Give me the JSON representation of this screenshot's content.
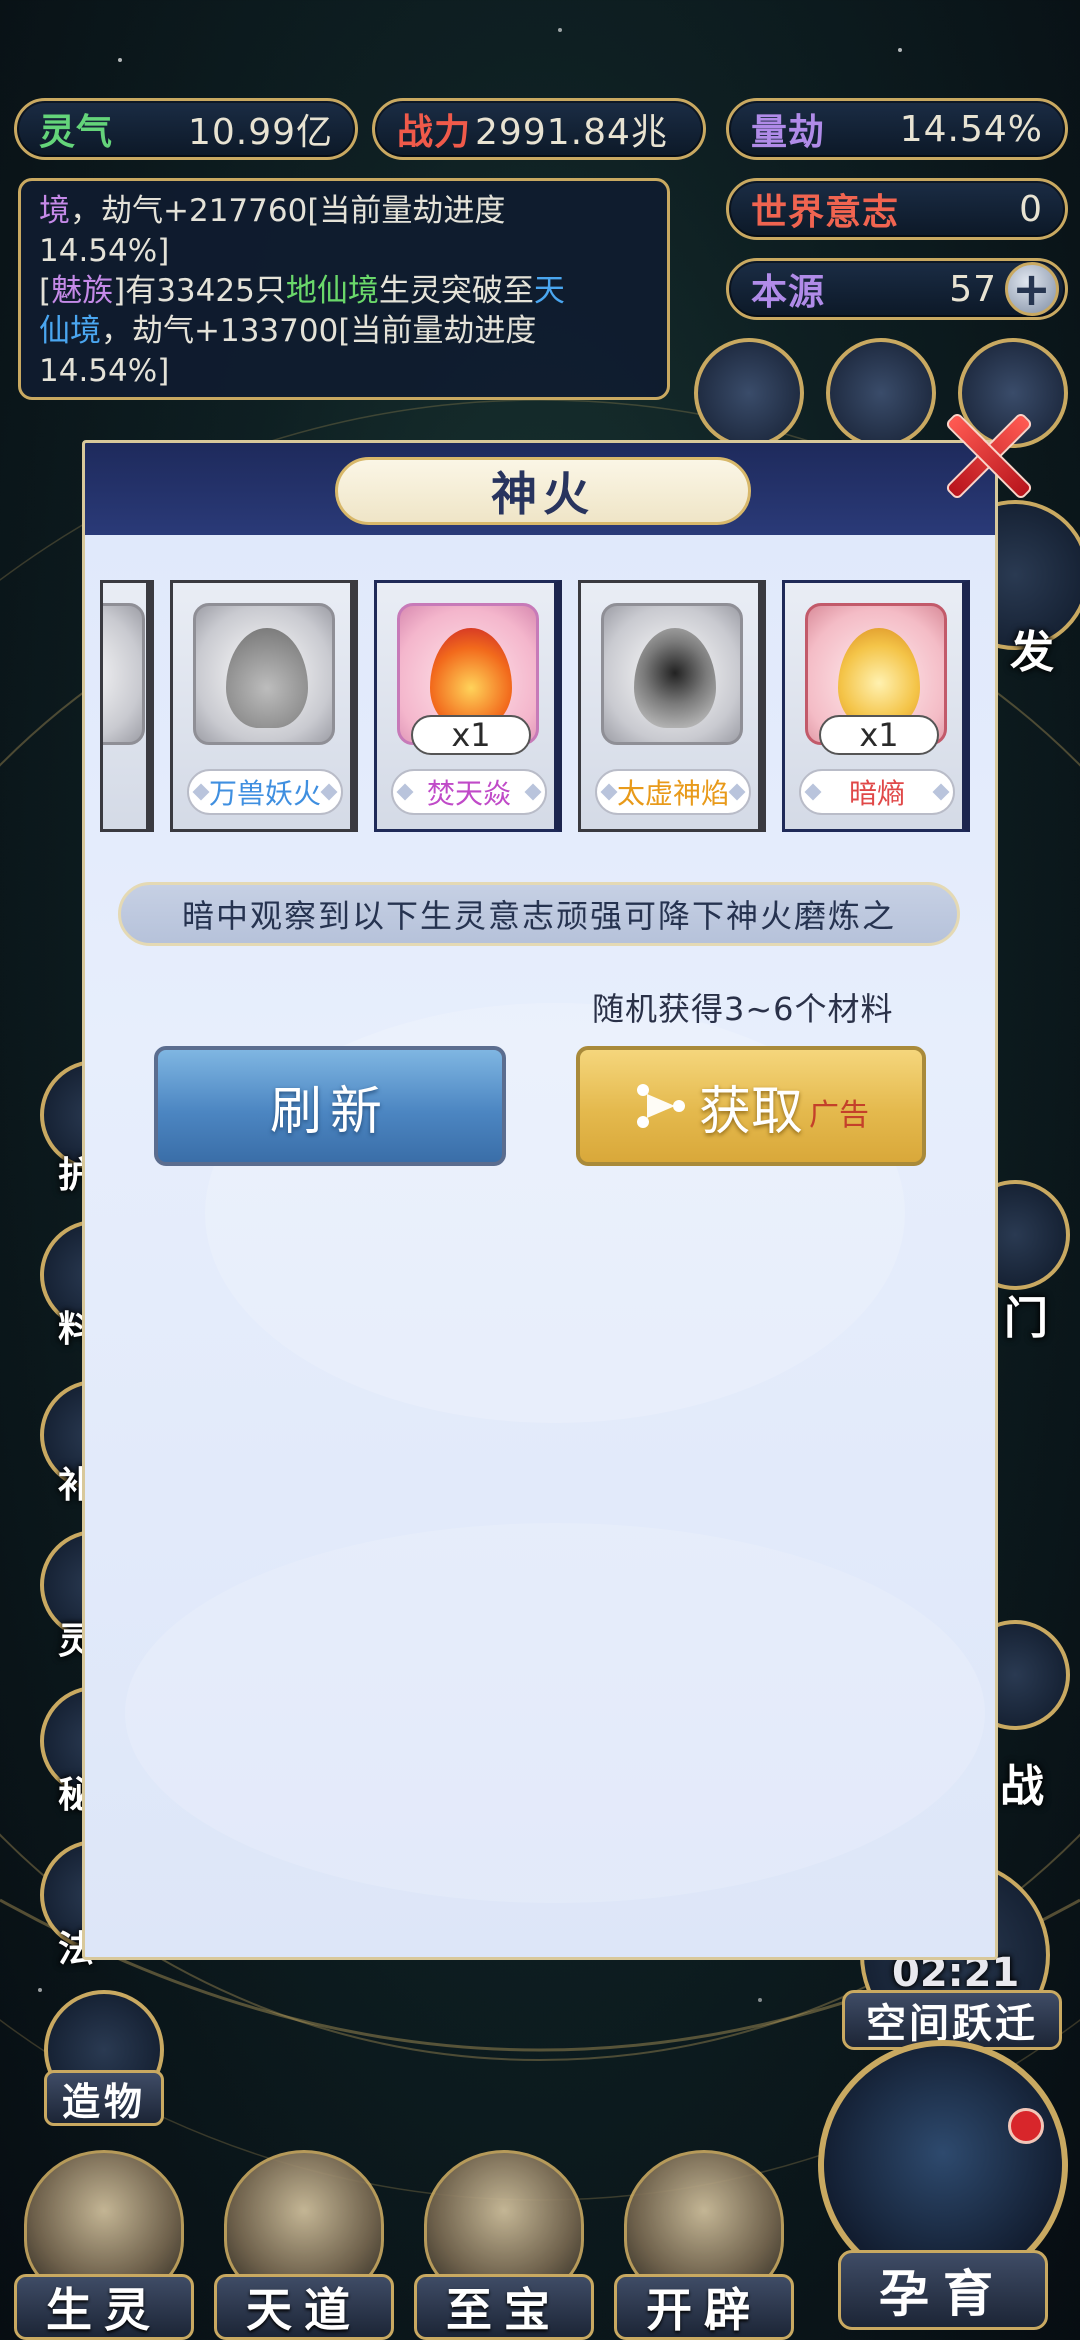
{
  "resources": {
    "lingqi": {
      "label": "灵气",
      "value": "10.99亿"
    },
    "zhanli": {
      "label": "战力",
      "value": "2991.84兆"
    },
    "liangjie": {
      "label": "量劫",
      "value": "14.54%"
    },
    "shijie_yizhi": {
      "label": "世界意志",
      "value": "0"
    },
    "benyuan": {
      "label": "本源",
      "value": "57",
      "plus": "+"
    }
  },
  "log": {
    "line1_a": "境",
    "line1_b": "，劫气+217760[当前量劫进度",
    "line2": "14.54%]",
    "line3_a": "[",
    "line3_race": "魅族",
    "line3_b": "]有33425只",
    "line3_realm": "地仙境",
    "line3_c": "生灵突破至",
    "line3_realm2": "天",
    "line4_realm2": "仙境",
    "line4_b": "，劫气+133700[当前量劫进度",
    "line5": "14.54%]"
  },
  "side": {
    "fa": "发",
    "men": "门",
    "zhan": "战",
    "timer": "02:21",
    "kongjian": "空间跃迁",
    "zaowu": "造物",
    "left_labels": [
      "护",
      "料",
      "补",
      "灵",
      "秘",
      "法"
    ]
  },
  "modal": {
    "title": "神火",
    "cards": [
      {
        "name": "万兽妖火",
        "qty": "",
        "name_color": "#3f8fe0"
      },
      {
        "name": "焚天焱",
        "qty": "x1",
        "name_color": "#c04ac8"
      },
      {
        "name": "太虚神焰",
        "qty": "",
        "name_color": "#e89a1a"
      },
      {
        "name": "暗熵",
        "qty": "x1",
        "name_color": "#e04848"
      }
    ],
    "hint": "暗中观察到以下生灵意志顽强可降下神火磨炼之",
    "material_hint": "随机获得3~6个材料",
    "refresh_label": "刷新",
    "get_label": "获取",
    "ad_label": "广告"
  },
  "nav": {
    "shengling": "生灵",
    "tiandao": "天道",
    "zhibao": "至宝",
    "kaipi": "开辟",
    "yunyu": "孕育"
  },
  "colors": {
    "gold_border": "#c9a961",
    "modal_header": "#1e2a5c",
    "close_red": "#d8262b"
  }
}
